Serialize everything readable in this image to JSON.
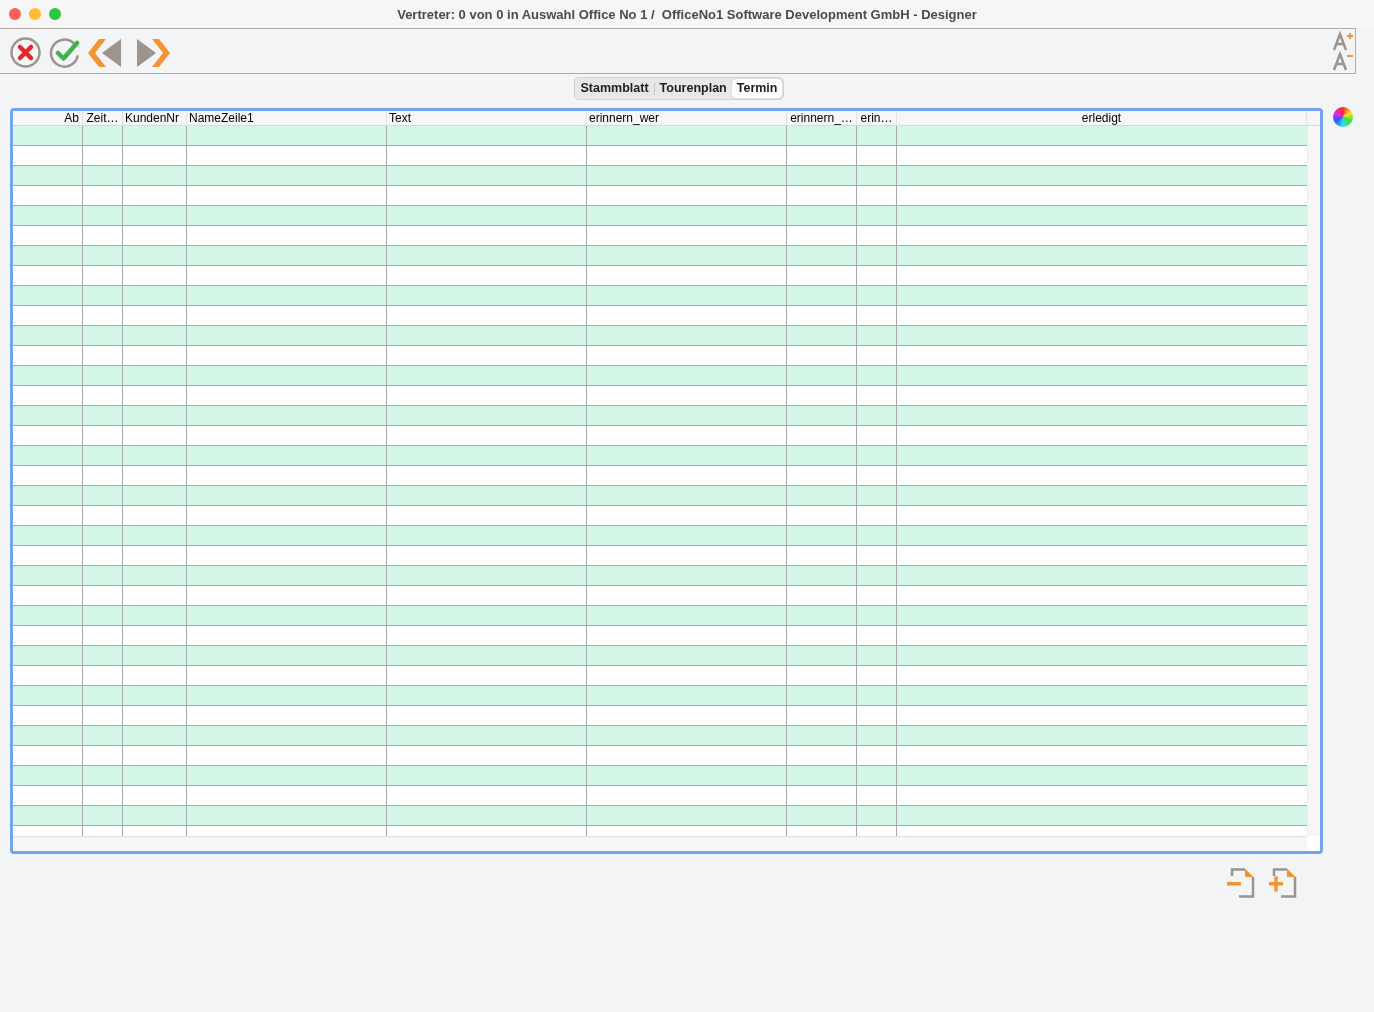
{
  "window": {
    "title": "Vertreter: 0 von 0 in Auswahl Office No 1 /  OfficeNo1 Software Development GmbH - Designer"
  },
  "tabs": [
    {
      "label": "Stammblatt",
      "selected": false
    },
    {
      "label": "Tourenplan",
      "selected": false
    },
    {
      "label": "Termin",
      "selected": true
    }
  ],
  "table": {
    "columns": [
      "Ab",
      "Zeit…",
      "KundenNr",
      "NameZeile1",
      "Text",
      "erinnern_wer",
      "erinnern_…",
      "erin…",
      "erledigt"
    ]
  }
}
